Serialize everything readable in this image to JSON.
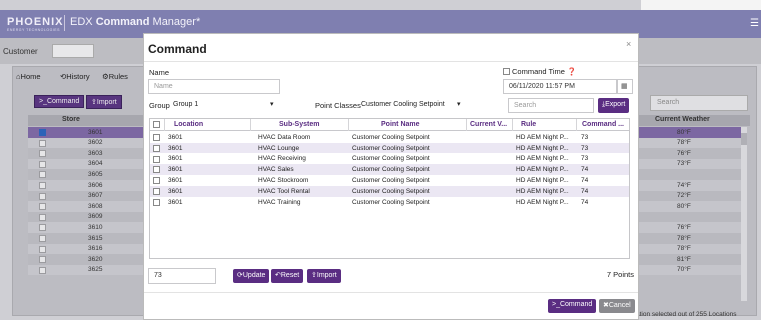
{
  "app": {
    "logo_main": "PHOENIX",
    "logo_sub": "ENERGY TECHNOLOGIES",
    "title_prefix": "EDX",
    "title_bold": "Command",
    "title_rest": "Manager*"
  },
  "customer": {
    "label": "Customer"
  },
  "tabs": [
    {
      "label": "Home",
      "icon": "home-icon"
    },
    {
      "label": "History",
      "icon": "history-icon"
    },
    {
      "label": "Rules",
      "icon": "gear-icon"
    }
  ],
  "background_toolbar": {
    "command_label": "Command",
    "import_label": "Import",
    "search_placeholder": "Search"
  },
  "background_table": {
    "headers": {
      "store": "Store",
      "weather": "Current Weather"
    },
    "rows": [
      {
        "store": "3601",
        "weather": "80°F",
        "checked": true
      },
      {
        "store": "3602",
        "weather": "78°F",
        "checked": false
      },
      {
        "store": "3603",
        "weather": "76°F",
        "checked": false
      },
      {
        "store": "3604",
        "weather": "73°F",
        "checked": false
      },
      {
        "store": "3605",
        "weather": "",
        "checked": false
      },
      {
        "store": "3606",
        "weather": "74°F",
        "checked": false
      },
      {
        "store": "3607",
        "weather": "72°F",
        "checked": false
      },
      {
        "store": "3608",
        "weather": "80°F",
        "checked": false
      },
      {
        "store": "3609",
        "weather": "",
        "checked": false
      },
      {
        "store": "3610",
        "weather": "76°F",
        "checked": false
      },
      {
        "store": "3615",
        "weather": "78°F",
        "checked": false
      },
      {
        "store": "3616",
        "weather": "78°F",
        "checked": false
      },
      {
        "store": "3620",
        "weather": "81°F",
        "checked": false
      },
      {
        "store": "3625",
        "weather": "70°F",
        "checked": false
      }
    ],
    "footer": "ation selected out of 255 Locations"
  },
  "modal": {
    "title": "Command",
    "close": "×",
    "name_label": "Name",
    "name_placeholder": "Name",
    "command_time_label": "Command Time",
    "command_time_value": "06/11/2020 11:57 PM",
    "group_label": "Group",
    "group_value": "Group 1",
    "point_classes_label": "Point Classes",
    "point_classes_value": "Customer Cooling Setpoint",
    "search_placeholder": "Search",
    "export_label": "Export",
    "columns": [
      "Location",
      "Sub-System",
      "Point Name",
      "Current V...",
      "Rule",
      "Command ..."
    ],
    "rows": [
      {
        "location": "3601",
        "subsystem": "HVAC Data Room",
        "point": "Customer Cooling Setpoint",
        "current": "",
        "rule": "HD AEM Night P...",
        "command": "73"
      },
      {
        "location": "3601",
        "subsystem": "HVAC Lounge",
        "point": "Customer Cooling Setpoint",
        "current": "",
        "rule": "HD AEM Night P...",
        "command": "73"
      },
      {
        "location": "3601",
        "subsystem": "HVAC Receiving",
        "point": "Customer Cooling Setpoint",
        "current": "",
        "rule": "HD AEM Night P...",
        "command": "73"
      },
      {
        "location": "3601",
        "subsystem": "HVAC Sales",
        "point": "Customer Cooling Setpoint",
        "current": "",
        "rule": "HD AEM Night P...",
        "command": "74"
      },
      {
        "location": "3601",
        "subsystem": "HVAC Stockroom",
        "point": "Customer Cooling Setpoint",
        "current": "",
        "rule": "HD AEM Night P...",
        "command": "74"
      },
      {
        "location": "3601",
        "subsystem": "HVAC Tool Rental",
        "point": "Customer Cooling Setpoint",
        "current": "",
        "rule": "HD AEM Night P...",
        "command": "74"
      },
      {
        "location": "3601",
        "subsystem": "HVAC Training",
        "point": "Customer Cooling Setpoint",
        "current": "",
        "rule": "HD AEM Night P...",
        "command": "74"
      }
    ],
    "value_input": "73",
    "update_label": "Update",
    "reset_label": "Reset",
    "import_label": "Import",
    "points_count": "7 Points",
    "command_button": "Command",
    "cancel_button": "Cancel"
  }
}
